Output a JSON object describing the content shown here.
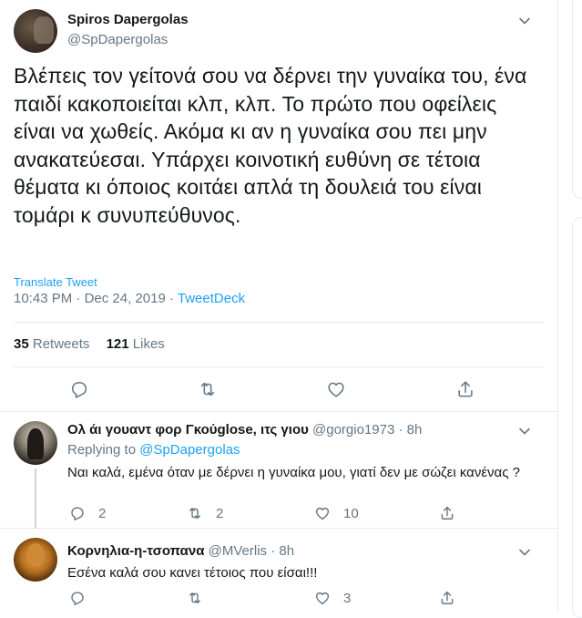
{
  "tweet": {
    "author_name": "Spiros Dapergolas",
    "author_handle": "@SpDapergolas",
    "text": "Βλέπεις τον γείτονά σου να δέρνει την γυναίκα του, ένα παιδί κακοποιείται κλπ, κλπ. Το πρώτο που οφείλεις είναι να χωθείς. Ακόμα κι αν η γυναίκα σου πει μην ανακατεύεσαι. Υπάρχει κοινοτική ευθύνη σε τέτοια θέματα κι όποιος κοιτάει απλά τη δουλειά του είναι τομάρι κ συνυπεύθυνος.",
    "translate_label": "Translate Tweet",
    "time": "10:43 PM",
    "date": "Dec 24, 2019",
    "separator": "·",
    "source": "TweetDeck",
    "retweets_count": "35",
    "retweets_label": "Retweets",
    "likes_count": "121",
    "likes_label": "Likes"
  },
  "replies": [
    {
      "name": "Ολ άι γουαντ φορ Γκούglose, ιτς γιου",
      "handle": "@gorgio1973",
      "separator": "·",
      "time": "8h",
      "replying_prefix": "Replying to",
      "replying_to": "@SpDapergolas",
      "text": "Ναι καλά, εμένα όταν με δέρνει η γυναίκα μου, γιατί δεν με σώζει κανένας ?",
      "reply_count": "2",
      "retweet_count": "2",
      "like_count": "10"
    },
    {
      "name": "Κορνηλια-η-τσοπανα",
      "handle": "@MVerlis",
      "separator": "·",
      "time": "8h",
      "text": "Εσένα καλά σου κανει τέτοιος που είσαι!!!",
      "reply_count": "",
      "retweet_count": "",
      "like_count": "3"
    }
  ],
  "icons": {
    "reply": "reply-icon",
    "retweet": "retweet-icon",
    "like": "heart-icon",
    "share": "share-icon",
    "more": "chevron-down-icon"
  },
  "colors": {
    "accent": "#1da1f2",
    "secondary_text": "#657786",
    "primary_text": "#14171a",
    "border": "#e6ecf0"
  }
}
